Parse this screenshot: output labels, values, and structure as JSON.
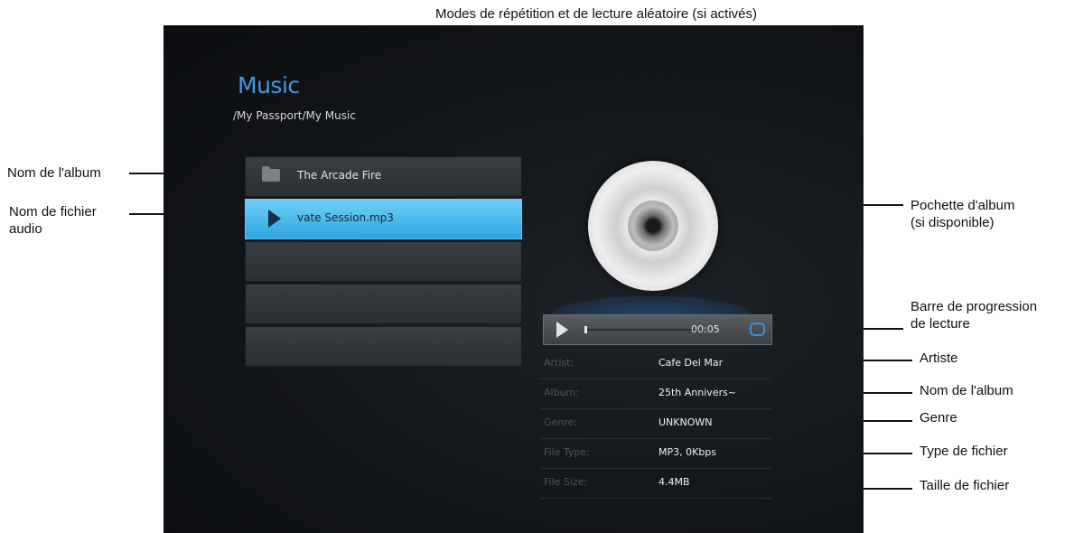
{
  "annotations": {
    "top": "Modes de répétition et de lecture aléatoire (si activés)",
    "left_album": "Nom de l'album",
    "left_file_line1": "Nom de fichier",
    "left_file_line2": "audio",
    "art_line1": "Pochette d'album",
    "art_line2": "(si disponible)",
    "progress_line1": "Barre de progression",
    "progress_line2": "de lecture",
    "artist": "Artiste",
    "album": "Nom de l'album",
    "genre": "Genre",
    "file_type": "Type de fichier",
    "file_size": "Taille de fichier"
  },
  "screen": {
    "title": "Music",
    "path": "/My Passport/My Music",
    "list": [
      {
        "label": "The Arcade Fire",
        "icon": "folder-icon",
        "selected": false
      },
      {
        "label": "vate Session.mp3",
        "icon": "play-icon",
        "selected": true
      },
      {
        "label": "",
        "selected": false
      },
      {
        "label": "",
        "selected": false
      },
      {
        "label": "",
        "selected": false
      }
    ],
    "player": {
      "time": "00:05",
      "progress": 0.0,
      "repeat_icon": "repeat-icon"
    },
    "info": {
      "artist_key": "Artist:",
      "artist_val": "Cafe Del Mar",
      "album_key": "Album:",
      "album_val": "25th Annivers~",
      "genre_key": "Genre:",
      "genre_val": "UNKNOWN",
      "type_key": "File Type:",
      "type_val": "MP3, 0Kbps",
      "size_key": "File Size:",
      "size_val": "4.4MB"
    }
  },
  "colors": {
    "accent": "#3c9be0",
    "selected_row": "#2ea6e0"
  }
}
